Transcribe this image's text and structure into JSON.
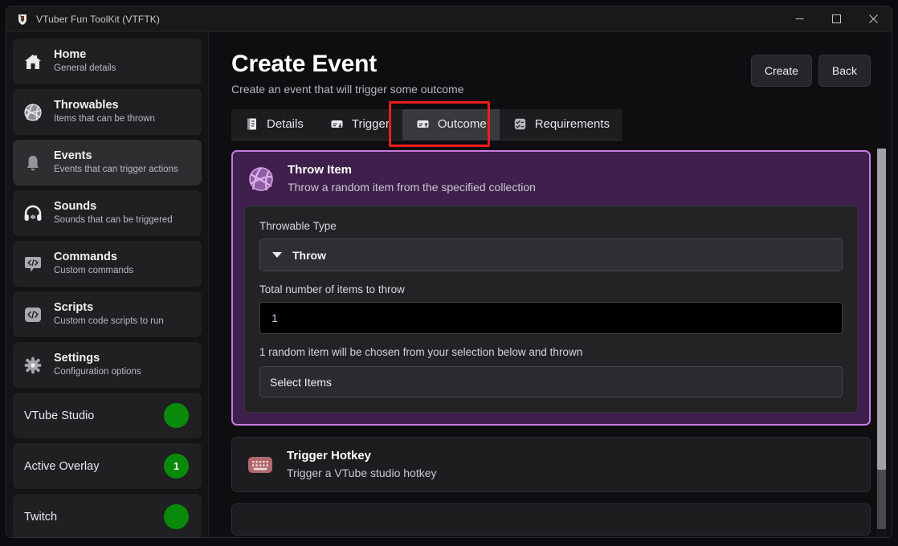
{
  "window": {
    "title": "VTuber Fun ToolKit (VTFTK)",
    "app_icon": "vtftk-logo-icon",
    "controls": {
      "minimize": "minimize-icon",
      "maximize": "maximize-icon",
      "close": "close-icon"
    }
  },
  "sidebar": {
    "items": [
      {
        "title": "Home",
        "subtitle": "General details",
        "icon": "home-icon",
        "active": false
      },
      {
        "title": "Throwables",
        "subtitle": "Items that can be thrown",
        "icon": "ball-icon",
        "active": false
      },
      {
        "title": "Events",
        "subtitle": "Events that can trigger actions",
        "icon": "bell-icon",
        "active": true
      },
      {
        "title": "Sounds",
        "subtitle": "Sounds that can be triggered",
        "icon": "headphones-icon",
        "active": false
      },
      {
        "title": "Commands",
        "subtitle": "Custom commands",
        "icon": "code-chat-icon",
        "active": false
      },
      {
        "title": "Scripts",
        "subtitle": "Custom code scripts to run",
        "icon": "code-icon",
        "active": false
      },
      {
        "title": "Settings",
        "subtitle": "Configuration options",
        "icon": "gear-icon",
        "active": false
      }
    ],
    "statuses": [
      {
        "label": "VTube Studio",
        "badge": "",
        "color": "#0a8a0a"
      },
      {
        "label": "Active Overlay",
        "badge": "1",
        "color": "#0a8a0a"
      },
      {
        "label": "Twitch",
        "badge": "",
        "color": "#0a8a0a"
      }
    ]
  },
  "page": {
    "title": "Create Event",
    "subtitle": "Create an event that will trigger some outcome",
    "actions": {
      "create_label": "Create",
      "back_label": "Back"
    }
  },
  "tabs": [
    {
      "label": "Details",
      "icon": "document-icon",
      "active": false
    },
    {
      "label": "Trigger",
      "icon": "inbox-down-icon",
      "active": false
    },
    {
      "label": "Outcome",
      "icon": "inbox-up-icon",
      "active": true
    },
    {
      "label": "Requirements",
      "icon": "checklist-icon",
      "active": false
    }
  ],
  "highlight": {
    "color": "#ee1b1b",
    "target": "Outcome"
  },
  "outcomes": [
    {
      "title": "Throw Item",
      "description": "Throw a random item from the specified collection",
      "icon": "ball-icon",
      "selected": true,
      "form": {
        "throwable_type_label": "Throwable Type",
        "throwable_type_value": "Throw",
        "total_items_label": "Total number of items to throw",
        "total_items_value": "1",
        "helper_text": "1 random item will be chosen from your selection below and thrown",
        "select_items_label": "Select Items"
      }
    },
    {
      "title": "Trigger Hotkey",
      "description": "Trigger a VTube studio hotkey",
      "icon": "keyboard-icon",
      "selected": false
    }
  ],
  "scrollbar": {
    "thumb_color": "#a0a0a5",
    "track_color": "#4a4a4d"
  }
}
